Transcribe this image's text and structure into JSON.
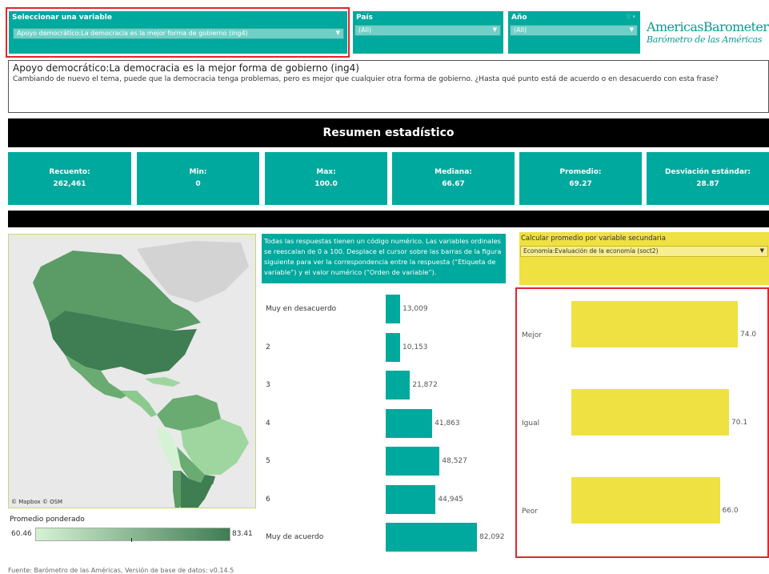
{
  "filters": {
    "variable": {
      "label": "Seleccionar una variable",
      "value": "Apoyo democrático:La democracia es la mejor forma de gobierno (ing4)"
    },
    "country": {
      "label": "País",
      "value": "(All)"
    },
    "year": {
      "label": "Año",
      "value": "(All)"
    }
  },
  "logo": {
    "line1": "AmericasBarometer",
    "line2": "Barómetro de las Américas"
  },
  "question": {
    "title": "Apoyo democrático:La democracia es la mejor forma de gobierno (ing4)",
    "text": "Cambiando de nuevo el tema, puede que la democracia tenga problemas, pero es mejor que cualquier otra forma de gobierno. ¿Hasta qué punto está de acuerdo o en desacuerdo con esta frase?"
  },
  "summary": {
    "title": "Resumen estadístico",
    "stats": [
      {
        "label": "Recuento:",
        "value": "262,461"
      },
      {
        "label": "Min:",
        "value": "0"
      },
      {
        "label": "Max:",
        "value": "100.0"
      },
      {
        "label": "Mediana:",
        "value": "66.67"
      },
      {
        "label": "Promedio:",
        "value": "69.27"
      },
      {
        "label": "Desviación estándar:",
        "value": "28.87"
      }
    ]
  },
  "map": {
    "credit": "© Mapbox © OSM",
    "legend_title": "Promedio ponderado",
    "legend_min": "60.46",
    "legend_max": "83.41",
    "colors": {
      "low": "#d6f2d4",
      "high": "#3f7d52"
    }
  },
  "info_text": "Todas las respuestas tienen un código numérico. Las variables ordinales se reescalan de 0 a 100. Desplace el cursor sobre las barras de la figura siguiente para ver la correspondencia entre la respuesta (“Etiqueta de variable”) y el valor numérico (“Orden de variable”).",
  "responses": {
    "labels": [
      "Muy en desacuerdo",
      "2",
      "3",
      "4",
      "5",
      "6",
      "Muy de acuerdo"
    ],
    "counts": [
      13009,
      10153,
      21872,
      41863,
      48527,
      44945,
      82092
    ],
    "count_labels": [
      "13,009",
      "10,153",
      "21,872",
      "41,863",
      "48,527",
      "44,945",
      "82,092"
    ],
    "color": "#00a99d"
  },
  "secondary": {
    "label": "Calcular promedio por variable secundaria",
    "value": "Economía:Evaluación de la economía (soct2)",
    "categories": [
      "Mejor",
      "Igual",
      "Peor"
    ],
    "values": [
      74.0,
      70.1,
      66.0
    ],
    "value_labels": [
      "74.0",
      "70.1",
      "66.0"
    ],
    "color": "#efe142"
  },
  "footer": "Fuente: Barómetro de las Américas, Versión de base de datos: v0.14.5"
}
